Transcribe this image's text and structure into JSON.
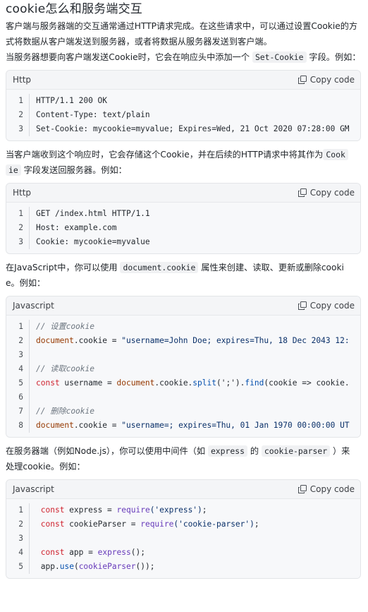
{
  "title": "cookie怎么和服务端交互",
  "intro": [
    "客户端与服务器端的交互通常通过HTTP请求完成。在这些请求中，可以通过设置Cookie的方式将数据从客户端发送到服务器，或者将数据从服务器发送到客户端。"
  ],
  "p1": {
    "before": "当服务器想要向客户端发送Cookie时，它会在响应头中添加一个",
    "code": "Set-Cookie",
    "after": "字段。例如："
  },
  "p2": {
    "before": "当客户端收到这个响应时，它会存储这个Cookie，并在后续的HTTP请求中将其作为",
    "code1": "Cook",
    "code2": "ie",
    "after": "字段发送回服务器。例如："
  },
  "p3": {
    "before": "在JavaScript中，你可以使用",
    "code": "document.cookie",
    "after": "属性来创建、读取、更新或删除cooki",
    "after2": "e。例如："
  },
  "p4": {
    "before": "在服务器端（例如Node.js），你可以使用中间件（如",
    "code1": "express",
    "mid": "的",
    "code2": "cookie-parser",
    "after": "）来",
    "after2": "处理cookie。例如："
  },
  "copy_label": "Copy code",
  "blocks": [
    {
      "lang": "Http",
      "lines": [
        {
          "n": "1",
          "text": "HTTP/1.1 200 OK"
        },
        {
          "n": "2",
          "text": "Content-Type: text/plain"
        },
        {
          "n": "3",
          "text": "Set-Cookie: mycookie=myvalue; Expires=Wed, 21 Oct 2020 07:28:00 GM"
        }
      ]
    },
    {
      "lang": "Http",
      "lines": [
        {
          "n": "1",
          "text": "GET /index.html HTTP/1.1"
        },
        {
          "n": "2",
          "text": "Host: example.com"
        },
        {
          "n": "3",
          "text": "Cookie: mycookie=myvalue"
        }
      ]
    },
    {
      "lang": "Javascript",
      "lines": [
        {
          "n": "1",
          "comment": "// 设置cookie"
        },
        {
          "n": "2",
          "a": "document",
          "b": ".cookie = ",
          "c": "\"username=John Doe; expires=Thu, 18 Dec 2043 12:"
        },
        {
          "n": "3"
        },
        {
          "n": "4",
          "comment": "// 读取cookie"
        },
        {
          "n": "5",
          "kw": "const",
          "b": " username = ",
          "a": "document",
          "c2": ".cookie.",
          "m1": "split",
          "d": "(';').",
          "m2": "find",
          "e": "(cookie => cookie."
        },
        {
          "n": "6"
        },
        {
          "n": "7",
          "comment": "// 删除cookie"
        },
        {
          "n": "8",
          "a": "document",
          "b": ".cookie = ",
          "c": "\"username=; expires=Thu, 01 Jan 1970 00:00:00 UT"
        }
      ]
    },
    {
      "lang": "Javascript",
      "lines": [
        {
          "n": "1",
          "kw": "const",
          "b": " express = ",
          "fn": "require",
          "s": "('express')",
          "end": ";"
        },
        {
          "n": "2",
          "kw": "const",
          "b": " cookieParser = ",
          "fn": "require",
          "s": "('cookie-parser')",
          "end": ";"
        },
        {
          "n": "3"
        },
        {
          "n": "4",
          "kw": "const",
          "b": " app = ",
          "fn": "express",
          "s": "()",
          "end": ";"
        },
        {
          "n": "5",
          "a2": "app",
          "b": ".",
          "m": "use",
          "s": "(",
          "fn": "cookieParser",
          "s2": "());"
        }
      ]
    }
  ]
}
